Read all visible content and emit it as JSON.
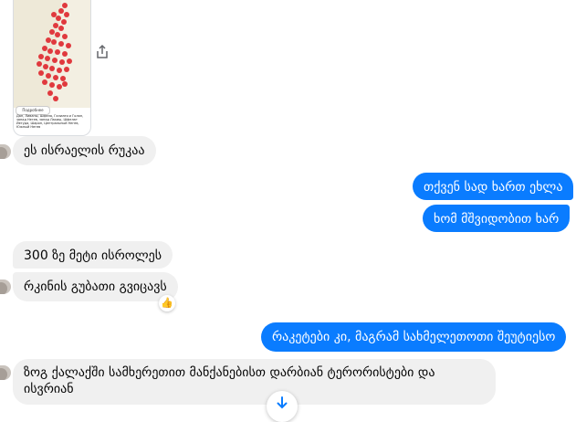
{
  "shared_map": {
    "button_label": "Подробнее",
    "caption": "Дан, Ливаны, Шфела, Галилея и Голан, запад Негев, запад Лахиш, Шфелат Йегуда, Шарон, Центральный Негев, Южный Негев"
  },
  "messages": [
    {
      "id": "m1",
      "direction": "in",
      "text": "ეს ისრაელის რუკაა"
    },
    {
      "id": "m2",
      "direction": "out",
      "text": "თქვენ სად ხართ ეხლა"
    },
    {
      "id": "m3",
      "direction": "out",
      "text": "ხომ მშვიდობით ხარ"
    },
    {
      "id": "m4",
      "direction": "in",
      "text": "300 ზე მეტი ისროლეს"
    },
    {
      "id": "m5",
      "direction": "in",
      "text": "რკინის გუბათი გვიცავს",
      "reaction": "👍"
    },
    {
      "id": "m6",
      "direction": "out",
      "text": "რაკეტები კი, მაგრამ სახმელეთოთი შეუტიესო"
    },
    {
      "id": "m7",
      "direction": "in",
      "text": "ზოგ ქალაქში სამხერეთით მანქანებისთ დარბიან ტერორისტები და ისვრიან"
    }
  ],
  "icons": {
    "share": "share-icon",
    "scroll_down": "arrow-down-icon",
    "reaction": "thumbs-up-icon"
  },
  "colors": {
    "outgoing_bubble": "#0a7cff",
    "incoming_bubble": "#f0f0f0"
  }
}
